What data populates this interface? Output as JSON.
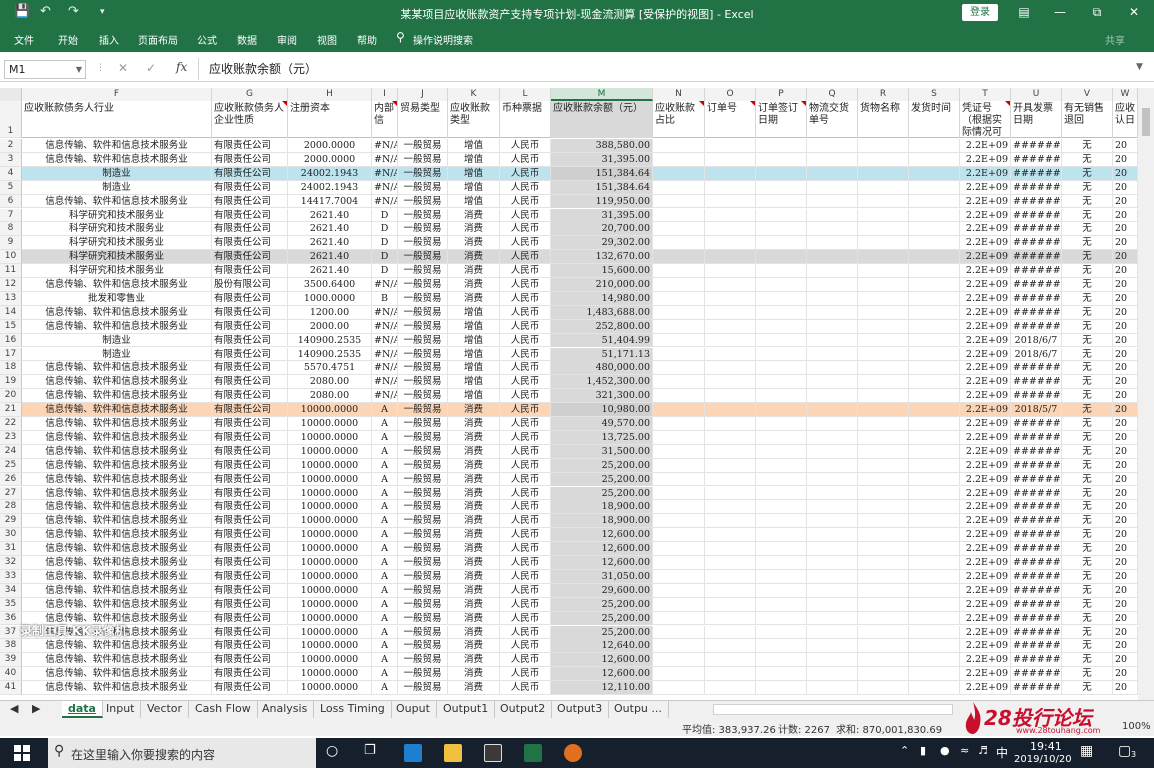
{
  "window": {
    "title": "某某项目应收账款资产支持专项计划-现金流测算  [受保护的视图]  -  Excel",
    "login_label": "登录",
    "share_label": "共享"
  },
  "ribbon": {
    "tabs": [
      "文件",
      "开始",
      "插入",
      "页面布局",
      "公式",
      "数据",
      "审阅",
      "视图",
      "帮助",
      "操作说明搜索"
    ]
  },
  "formula_bar": {
    "name_box": "M1",
    "fx_label": "fx",
    "content": "应收账款余额（元）"
  },
  "columns": [
    "F",
    "G",
    "H",
    "I",
    "J",
    "K",
    "L",
    "M",
    "N",
    "O",
    "P",
    "Q",
    "R",
    "S",
    "T",
    "U",
    "V",
    "W"
  ],
  "headers": {
    "F": "应收账款债务人行业",
    "G": "应收账款债务人企业性质",
    "H": "注册资本",
    "I": "内部信",
    "J": "贸易类型",
    "K": "应收账款类型",
    "L": "币种票据",
    "M": "应收账款余额（元）",
    "N": "应收账款占比",
    "O": "订单号",
    "P": "订单签订日期",
    "Q": "物流交货单号",
    "R": "货物名称",
    "S": "发货时间",
    "T": "凭证号（根据实际情况可",
    "U": "开具发票日期",
    "V": "有无销售退回",
    "W": "应收认日"
  },
  "rows": [
    {
      "n": "2",
      "F": "信息传输、软件和信息技术服务业",
      "G": "有限责任公司",
      "H": "2000.0000",
      "I": "#N/A",
      "J": "一般贸易",
      "K": "增值",
      "L": "人民币",
      "M": "388,580.00",
      "T": "2.2E+09",
      "U": "########",
      "V": "无",
      "W": "20"
    },
    {
      "n": "3",
      "F": "信息传输、软件和信息技术服务业",
      "G": "有限责任公司",
      "H": "2000.0000",
      "I": "#N/A",
      "J": "一般贸易",
      "K": "增值",
      "L": "人民币",
      "M": "31,395.00",
      "T": "2.2E+09",
      "U": "########",
      "V": "无",
      "W": "20"
    },
    {
      "n": "4",
      "F": "制造业",
      "G": "有限责任公司",
      "H": "24002.1943",
      "I": "#N/A",
      "J": "一般贸易",
      "K": "增值",
      "L": "人民币",
      "M": "151,384.64",
      "T": "2.2E+09",
      "U": "########",
      "V": "无",
      "W": "20",
      "hl": "blue"
    },
    {
      "n": "5",
      "F": "制造业",
      "G": "有限责任公司",
      "H": "24002.1943",
      "I": "#N/A",
      "J": "一般贸易",
      "K": "增值",
      "L": "人民币",
      "M": "151,384.64",
      "T": "2.2E+09",
      "U": "########",
      "V": "无",
      "W": "20"
    },
    {
      "n": "6",
      "F": "信息传输、软件和信息技术服务业",
      "G": "有限责任公司",
      "H": "14417.7004",
      "I": "#N/A",
      "J": "一般贸易",
      "K": "增值",
      "L": "人民币",
      "M": "119,950.00",
      "T": "2.2E+09",
      "U": "########",
      "V": "无",
      "W": "20"
    },
    {
      "n": "7",
      "F": "科学研究和技术服务业",
      "G": "有限责任公司",
      "H": "2621.40",
      "I": "D",
      "J": "一般贸易",
      "K": "消费",
      "L": "人民币",
      "M": "31,395.00",
      "T": "2.2E+09",
      "U": "########",
      "V": "无",
      "W": "20"
    },
    {
      "n": "8",
      "F": "科学研究和技术服务业",
      "G": "有限责任公司",
      "H": "2621.40",
      "I": "D",
      "J": "一般贸易",
      "K": "消费",
      "L": "人民币",
      "M": "20,700.00",
      "T": "2.2E+09",
      "U": "########",
      "V": "无",
      "W": "20"
    },
    {
      "n": "9",
      "F": "科学研究和技术服务业",
      "G": "有限责任公司",
      "H": "2621.40",
      "I": "D",
      "J": "一般贸易",
      "K": "消费",
      "L": "人民币",
      "M": "29,302.00",
      "T": "2.2E+09",
      "U": "########",
      "V": "无",
      "W": "20"
    },
    {
      "n": "10",
      "F": "科学研究和技术服务业",
      "G": "有限责任公司",
      "H": "2621.40",
      "I": "D",
      "J": "一般贸易",
      "K": "消费",
      "L": "人民币",
      "M": "132,670.00",
      "T": "2.2E+09",
      "U": "########",
      "V": "无",
      "W": "20",
      "hl": "gray"
    },
    {
      "n": "11",
      "F": "科学研究和技术服务业",
      "G": "有限责任公司",
      "H": "2621.40",
      "I": "D",
      "J": "一般贸易",
      "K": "消费",
      "L": "人民币",
      "M": "15,600.00",
      "T": "2.2E+09",
      "U": "########",
      "V": "无",
      "W": "20"
    },
    {
      "n": "12",
      "F": "信息传输、软件和信息技术服务业",
      "G": "股份有限公司",
      "H": "3500.6400",
      "I": "#N/A",
      "J": "一般贸易",
      "K": "消费",
      "L": "人民币",
      "M": "210,000.00",
      "T": "2.2E+09",
      "U": "########",
      "V": "无",
      "W": "20"
    },
    {
      "n": "13",
      "F": "批发和零售业",
      "G": "有限责任公司",
      "H": "1000.0000",
      "I": "B",
      "J": "一般贸易",
      "K": "消费",
      "L": "人民币",
      "M": "14,980.00",
      "T": "2.2E+09",
      "U": "########",
      "V": "无",
      "W": "20"
    },
    {
      "n": "14",
      "F": "信息传输、软件和信息技术服务业",
      "G": "有限责任公司",
      "H": "1200.00",
      "I": "#N/A",
      "J": "一般贸易",
      "K": "增值",
      "L": "人民币",
      "M": "1,483,688.00",
      "T": "2.2E+09",
      "U": "########",
      "V": "无",
      "W": "20"
    },
    {
      "n": "15",
      "F": "信息传输、软件和信息技术服务业",
      "G": "有限责任公司",
      "H": "2000.00",
      "I": "#N/A",
      "J": "一般贸易",
      "K": "增值",
      "L": "人民币",
      "M": "252,800.00",
      "T": "2.2E+09",
      "U": "########",
      "V": "无",
      "W": "20"
    },
    {
      "n": "16",
      "F": "制造业",
      "G": "有限责任公司",
      "H": "140900.2535",
      "I": "#N/A",
      "J": "一般贸易",
      "K": "增值",
      "L": "人民币",
      "M": "51,404.99",
      "T": "2.2E+09",
      "U": "2018/6/7",
      "V": "无",
      "W": "20"
    },
    {
      "n": "17",
      "F": "制造业",
      "G": "有限责任公司",
      "H": "140900.2535",
      "I": "#N/A",
      "J": "一般贸易",
      "K": "增值",
      "L": "人民币",
      "M": "51,171.13",
      "T": "2.2E+09",
      "U": "2018/6/7",
      "V": "无",
      "W": "20"
    },
    {
      "n": "18",
      "F": "信息传输、软件和信息技术服务业",
      "G": "有限责任公司",
      "H": "5570.4751",
      "I": "#N/A",
      "J": "一般贸易",
      "K": "增值",
      "L": "人民币",
      "M": "480,000.00",
      "T": "2.2E+09",
      "U": "########",
      "V": "无",
      "W": "20"
    },
    {
      "n": "19",
      "F": "信息传输、软件和信息技术服务业",
      "G": "有限责任公司",
      "H": "2080.00",
      "I": "#N/A",
      "J": "一般贸易",
      "K": "增值",
      "L": "人民币",
      "M": "1,452,300.00",
      "T": "2.2E+09",
      "U": "########",
      "V": "无",
      "W": "20"
    },
    {
      "n": "20",
      "F": "信息传输、软件和信息技术服务业",
      "G": "有限责任公司",
      "H": "2080.00",
      "I": "#N/A",
      "J": "一般贸易",
      "K": "增值",
      "L": "人民币",
      "M": "321,300.00",
      "T": "2.2E+09",
      "U": "########",
      "V": "无",
      "W": "20"
    },
    {
      "n": "21",
      "F": "信息传输、软件和信息技术服务业",
      "G": "有限责任公司",
      "H": "10000.0000",
      "I": "A",
      "J": "一般贸易",
      "K": "消费",
      "L": "人民币",
      "M": "10,980.00",
      "T": "2.2E+09",
      "U": "2018/5/7",
      "V": "无",
      "W": "20",
      "hl": "orange"
    },
    {
      "n": "22",
      "F": "信息传输、软件和信息技术服务业",
      "G": "有限责任公司",
      "H": "10000.0000",
      "I": "A",
      "J": "一般贸易",
      "K": "消费",
      "L": "人民币",
      "M": "49,570.00",
      "T": "2.2E+09",
      "U": "########",
      "V": "无",
      "W": "20"
    },
    {
      "n": "23",
      "F": "信息传输、软件和信息技术服务业",
      "G": "有限责任公司",
      "H": "10000.0000",
      "I": "A",
      "J": "一般贸易",
      "K": "消费",
      "L": "人民币",
      "M": "13,725.00",
      "T": "2.2E+09",
      "U": "########",
      "V": "无",
      "W": "20"
    },
    {
      "n": "24",
      "F": "信息传输、软件和信息技术服务业",
      "G": "有限责任公司",
      "H": "10000.0000",
      "I": "A",
      "J": "一般贸易",
      "K": "消费",
      "L": "人民币",
      "M": "31,500.00",
      "T": "2.2E+09",
      "U": "########",
      "V": "无",
      "W": "20"
    },
    {
      "n": "25",
      "F": "信息传输、软件和信息技术服务业",
      "G": "有限责任公司",
      "H": "10000.0000",
      "I": "A",
      "J": "一般贸易",
      "K": "消费",
      "L": "人民币",
      "M": "25,200.00",
      "T": "2.2E+09",
      "U": "########",
      "V": "无",
      "W": "20"
    },
    {
      "n": "26",
      "F": "信息传输、软件和信息技术服务业",
      "G": "有限责任公司",
      "H": "10000.0000",
      "I": "A",
      "J": "一般贸易",
      "K": "消费",
      "L": "人民币",
      "M": "25,200.00",
      "T": "2.2E+09",
      "U": "########",
      "V": "无",
      "W": "20"
    },
    {
      "n": "27",
      "F": "信息传输、软件和信息技术服务业",
      "G": "有限责任公司",
      "H": "10000.0000",
      "I": "A",
      "J": "一般贸易",
      "K": "消费",
      "L": "人民币",
      "M": "25,200.00",
      "T": "2.2E+09",
      "U": "########",
      "V": "无",
      "W": "20"
    },
    {
      "n": "28",
      "F": "信息传输、软件和信息技术服务业",
      "G": "有限责任公司",
      "H": "10000.0000",
      "I": "A",
      "J": "一般贸易",
      "K": "消费",
      "L": "人民币",
      "M": "18,900.00",
      "T": "2.2E+09",
      "U": "########",
      "V": "无",
      "W": "20"
    },
    {
      "n": "29",
      "F": "信息传输、软件和信息技术服务业",
      "G": "有限责任公司",
      "H": "10000.0000",
      "I": "A",
      "J": "一般贸易",
      "K": "消费",
      "L": "人民币",
      "M": "18,900.00",
      "T": "2.2E+09",
      "U": "########",
      "V": "无",
      "W": "20"
    },
    {
      "n": "30",
      "F": "信息传输、软件和信息技术服务业",
      "G": "有限责任公司",
      "H": "10000.0000",
      "I": "A",
      "J": "一般贸易",
      "K": "消费",
      "L": "人民币",
      "M": "12,600.00",
      "T": "2.2E+09",
      "U": "########",
      "V": "无",
      "W": "20"
    },
    {
      "n": "31",
      "F": "信息传输、软件和信息技术服务业",
      "G": "有限责任公司",
      "H": "10000.0000",
      "I": "A",
      "J": "一般贸易",
      "K": "消费",
      "L": "人民币",
      "M": "12,600.00",
      "T": "2.2E+09",
      "U": "########",
      "V": "无",
      "W": "20"
    },
    {
      "n": "32",
      "F": "信息传输、软件和信息技术服务业",
      "G": "有限责任公司",
      "H": "10000.0000",
      "I": "A",
      "J": "一般贸易",
      "K": "消费",
      "L": "人民币",
      "M": "12,600.00",
      "T": "2.2E+09",
      "U": "########",
      "V": "无",
      "W": "20"
    },
    {
      "n": "33",
      "F": "信息传输、软件和信息技术服务业",
      "G": "有限责任公司",
      "H": "10000.0000",
      "I": "A",
      "J": "一般贸易",
      "K": "消费",
      "L": "人民币",
      "M": "31,050.00",
      "T": "2.2E+09",
      "U": "########",
      "V": "无",
      "W": "20"
    },
    {
      "n": "34",
      "F": "信息传输、软件和信息技术服务业",
      "G": "有限责任公司",
      "H": "10000.0000",
      "I": "A",
      "J": "一般贸易",
      "K": "消费",
      "L": "人民币",
      "M": "29,600.00",
      "T": "2.2E+09",
      "U": "########",
      "V": "无",
      "W": "20"
    },
    {
      "n": "35",
      "F": "信息传输、软件和信息技术服务业",
      "G": "有限责任公司",
      "H": "10000.0000",
      "I": "A",
      "J": "一般贸易",
      "K": "消费",
      "L": "人民币",
      "M": "25,200.00",
      "T": "2.2E+09",
      "U": "########",
      "V": "无",
      "W": "20"
    },
    {
      "n": "36",
      "F": "信息传输、软件和信息技术服务业",
      "G": "有限责任公司",
      "H": "10000.0000",
      "I": "A",
      "J": "一般贸易",
      "K": "消费",
      "L": "人民币",
      "M": "25,200.00",
      "T": "2.2E+09",
      "U": "########",
      "V": "无",
      "W": "20"
    },
    {
      "n": "37",
      "F": "信息传输、软件和信息技术服务业",
      "G": "有限责任公司",
      "H": "10000.0000",
      "I": "A",
      "J": "一般贸易",
      "K": "消费",
      "L": "人民币",
      "M": "25,200.00",
      "T": "2.2E+09",
      "U": "########",
      "V": "无",
      "W": "20"
    },
    {
      "n": "38",
      "F": "信息传输、软件和信息技术服务业",
      "G": "有限责任公司",
      "H": "10000.0000",
      "I": "A",
      "J": "一般贸易",
      "K": "消费",
      "L": "人民币",
      "M": "12,640.00",
      "T": "2.2E+09",
      "U": "########",
      "V": "无",
      "W": "20"
    },
    {
      "n": "39",
      "F": "信息传输、软件和信息技术服务业",
      "G": "有限责任公司",
      "H": "10000.0000",
      "I": "A",
      "J": "一般贸易",
      "K": "消费",
      "L": "人民币",
      "M": "12,600.00",
      "T": "2.2E+09",
      "U": "########",
      "V": "无",
      "W": "20"
    },
    {
      "n": "40",
      "F": "信息传输、软件和信息技术服务业",
      "G": "有限责任公司",
      "H": "10000.0000",
      "I": "A",
      "J": "一般贸易",
      "K": "消费",
      "L": "人民币",
      "M": "12,600.00",
      "T": "2.2E+09",
      "U": "########",
      "V": "无",
      "W": "20"
    },
    {
      "n": "41",
      "F": "信息传输、软件和信息技术服务业",
      "G": "有限责任公司",
      "H": "10000.0000",
      "I": "A",
      "J": "一般贸易",
      "K": "消费",
      "L": "人民币",
      "M": "12,110.00",
      "T": "2.2E+09",
      "U": "########",
      "V": "无",
      "W": "20"
    }
  ],
  "sheet_tabs": [
    "data",
    "Input",
    "Vector",
    "Cash Flow",
    "Analysis",
    "Loss Timing",
    "Ouput",
    "Output1",
    "Output2",
    "Output3",
    "Outpu ..."
  ],
  "active_tab": "data",
  "status_bar": {
    "average": "平均值: 383,937.26",
    "count": "计数: 2267",
    "sum": "求和: 870,001,830.69",
    "zoom": "100%"
  },
  "logo": {
    "name": "28投行论坛",
    "url": "www.28touhang.com"
  },
  "watermark": "录制工具 KK录像机",
  "taskbar": {
    "search_placeholder": "在这里输入你要搜索的内容",
    "ime": "中",
    "time": "19:41",
    "date": "2019/10/20",
    "notification_count": "3"
  }
}
